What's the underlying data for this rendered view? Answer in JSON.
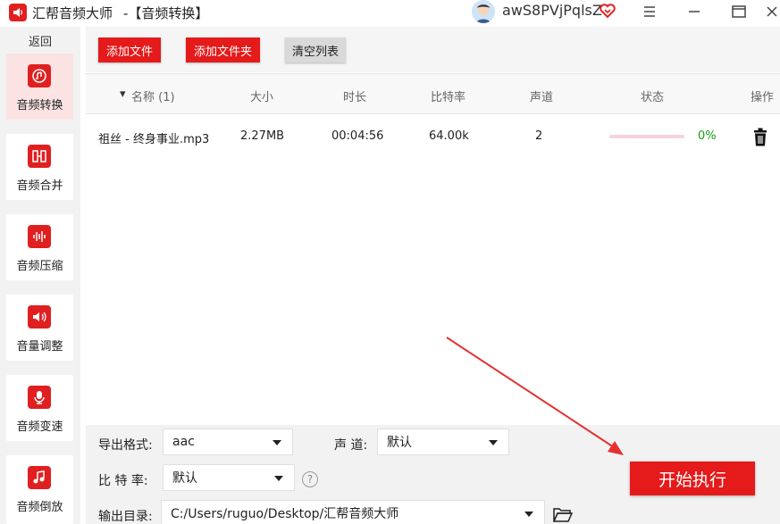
{
  "app": {
    "title": "汇帮音频大师",
    "page_title": "-【音频转换】",
    "username": "awS8PVjPqlsZ",
    "window_controls": [
      "menu-icon",
      "minimize-icon",
      "maximize-icon",
      "close-icon"
    ]
  },
  "sidebar": {
    "back_label": "返回",
    "items": [
      {
        "label": "音频转换",
        "icon": "audio-convert-icon",
        "active": true
      },
      {
        "label": "音频合并",
        "icon": "audio-merge-icon",
        "active": false
      },
      {
        "label": "音频压缩",
        "icon": "audio-compress-icon",
        "active": false
      },
      {
        "label": "音量调整",
        "icon": "volume-adjust-icon",
        "active": false
      },
      {
        "label": "音频变速",
        "icon": "audio-speed-icon",
        "active": false
      },
      {
        "label": "音频倒放",
        "icon": "audio-reverse-icon",
        "active": false
      }
    ]
  },
  "toolbar": {
    "add_file": "添加文件",
    "add_folder": "添加文件夹",
    "clear_list": "清空列表"
  },
  "table": {
    "columns": {
      "name": "名称 (1)",
      "size": "大小",
      "duration": "时长",
      "bitrate": "比特率",
      "channels": "声道",
      "status": "状态",
      "action": "操作"
    },
    "rows": [
      {
        "name": "祖丝 - 终身事业.mp3",
        "size": "2.27MB",
        "duration": "00:04:56",
        "bitrate": "64.00k",
        "channels": "2",
        "progress": 0,
        "status": "0%"
      }
    ]
  },
  "settings": {
    "format_label": "导出格式:",
    "format_value": "aac",
    "channel_label": "声 道:",
    "channel_value": "默认",
    "bitrate_label": "比 特 率:",
    "bitrate_value": "默认",
    "output_label": "输出目录:",
    "output_value": "C:/Users/ruguo/Desktop/汇帮音频大师",
    "start_button": "开始执行"
  },
  "colors": {
    "brand": "#e51a1a",
    "progress_track": "#f6d2dc",
    "status_text": "#1a9a1a",
    "arrow": "#e53030"
  }
}
